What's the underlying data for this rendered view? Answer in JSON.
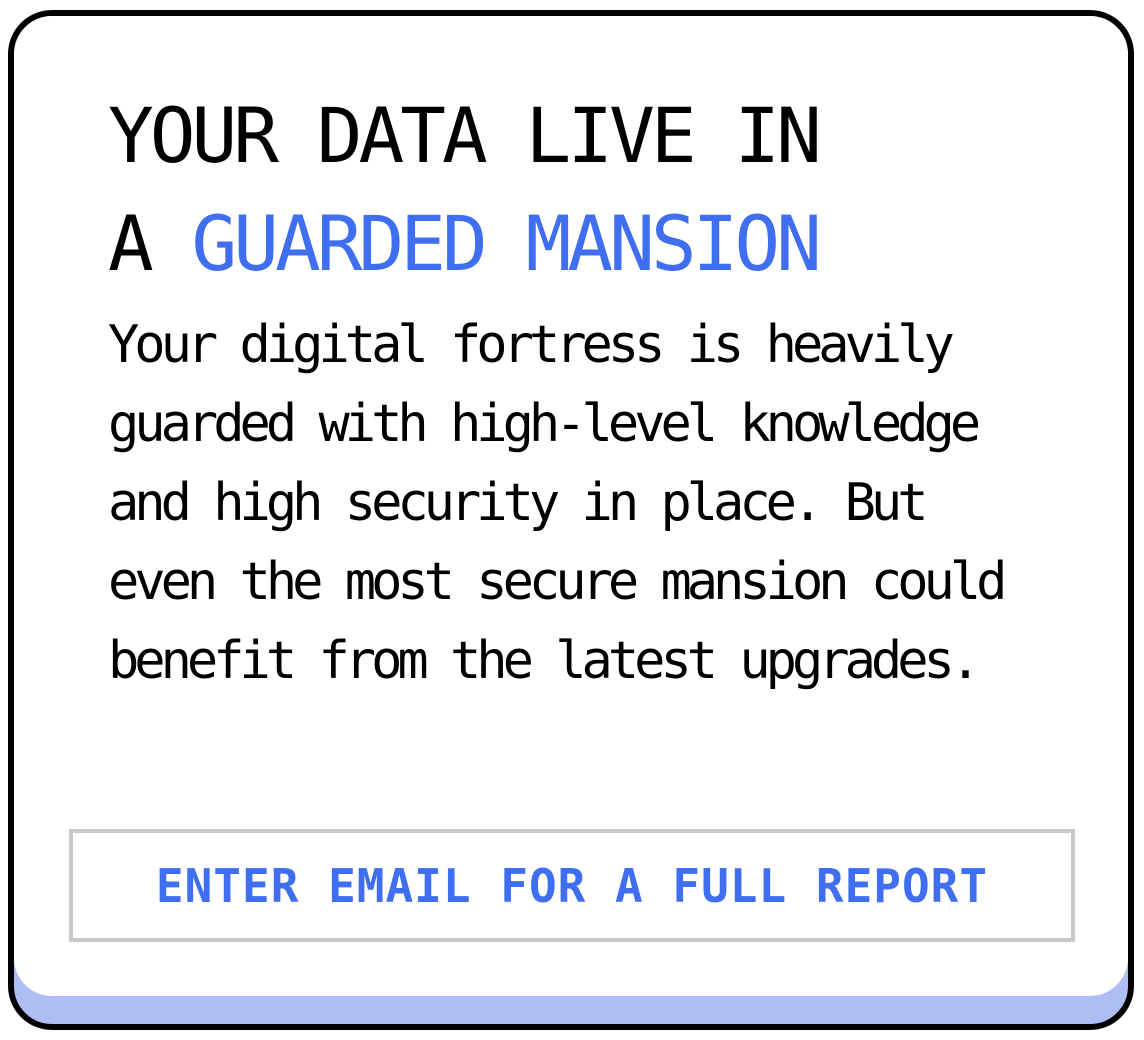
{
  "headline": {
    "line1": "YOUR DATA LIVE IN",
    "line2_prefix": "A ",
    "line2_accent": "GUARDED MANSION"
  },
  "body": {
    "text": "Your digital fortress is heavily guarded with high-level knowledge and high security in place. But even the most secure mansion could benefit from the latest upgrades."
  },
  "cta": {
    "label": "ENTER EMAIL FOR A FULL REPORT"
  },
  "colors": {
    "accent": "#3f6ef0",
    "card_shadow": "#aebdf4",
    "border": "#000000",
    "cta_border": "#c8c8c8"
  }
}
